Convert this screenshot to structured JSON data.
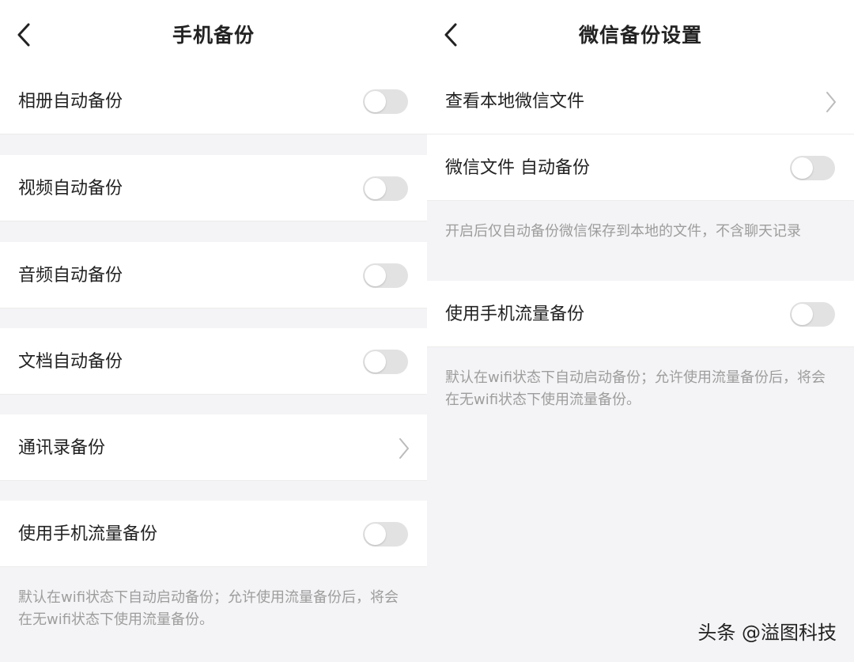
{
  "left": {
    "title": "手机备份",
    "rows": [
      {
        "label": "相册自动备份",
        "control": "toggle",
        "on": false
      },
      {
        "label": "视频自动备份",
        "control": "toggle",
        "on": false
      },
      {
        "label": "音频自动备份",
        "control": "toggle",
        "on": false
      },
      {
        "label": "文档自动备份",
        "control": "toggle",
        "on": false
      },
      {
        "label": "通讯录备份",
        "control": "chevron"
      },
      {
        "label": "使用手机流量备份",
        "control": "toggle",
        "on": false
      }
    ],
    "note": "默认在wifi状态下自动启动备份；允许使用流量备份后，将会在无wifi状态下使用流量备份。"
  },
  "right": {
    "title": "微信备份设置",
    "rows": [
      {
        "label": "查看本地微信文件",
        "control": "chevron"
      },
      {
        "label": "微信文件 自动备份",
        "control": "toggle",
        "on": false
      },
      {
        "label": "使用手机流量备份",
        "control": "toggle",
        "on": false
      }
    ],
    "note1": "开启后仅自动备份微信保存到本地的文件，不含聊天记录",
    "note2": "默认在wifi状态下自动启动备份；允许使用流量备份后，将会在无wifi状态下使用流量备份。"
  },
  "watermark": "头条 @溢图科技",
  "colors": {
    "toggle_off": "#e2e2e2",
    "background": "#f4f4f6",
    "note_text": "#9d9d9d"
  },
  "icons": {
    "back": "chevron-left-icon",
    "forward": "chevron-right-icon"
  }
}
